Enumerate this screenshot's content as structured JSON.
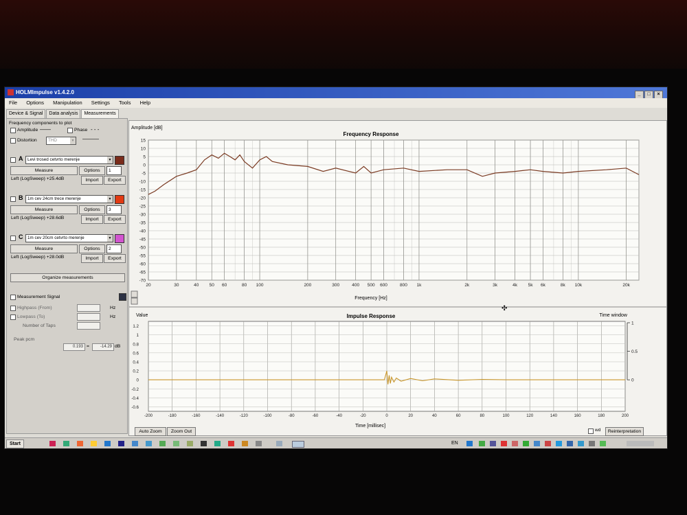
{
  "app": {
    "title": "HOLMImpulse  v1.4.2.0"
  },
  "menu": [
    "File",
    "Options",
    "Manipulation",
    "Settings",
    "Tools",
    "Help"
  ],
  "tabs": [
    "Device & Signal",
    "Data analysis",
    "Measurements"
  ],
  "left": {
    "components_title": "Frequency components to plot",
    "amplitude": "Amplitude",
    "phase": "Phase",
    "distortion": "Distortion",
    "thd": "THD",
    "measurements": [
      {
        "letter": "A",
        "name": "Levi trosed cetvrto merenje",
        "color": "#7a2b1a",
        "measure": "Measure",
        "options": "Options",
        "num": "1",
        "info": "Left (LogSweep) +25.4dB",
        "import": "Import",
        "export": "Export"
      },
      {
        "letter": "B",
        "name": "1m cev 24cm trece merenje",
        "color": "#e23a12",
        "measure": "Measure",
        "options": "Options",
        "num": "3",
        "info": "Left (LogSweep) +28.6dB",
        "import": "Import",
        "export": "Export"
      },
      {
        "letter": "C",
        "name": "1m cev 20cm cetvrto merenje",
        "color": "#d255cf",
        "measure": "Measure",
        "options": "Options",
        "num": "2",
        "info": "Left (LogSweep) +28.0dB",
        "import": "Import",
        "export": "Export"
      }
    ],
    "organize": "Organize measurements",
    "measurement_signal": "Measurement Signal",
    "highpass": "Highpass (From)",
    "lowpass": "Lowpass (To)",
    "taps": "Number of Taps",
    "hz": "Hz",
    "peak_label": "Peak pcm",
    "peak_value": "0.193",
    "peak_equals": "=",
    "peak_db": "-14.29",
    "db": "dB"
  },
  "chart_data": [
    {
      "type": "line",
      "title": "Frequency Response",
      "ylabel": "Amplitude [dB]",
      "xlabel": "Frequency [Hz]",
      "x_scale": "log",
      "xlim": [
        20,
        24000
      ],
      "ylim": [
        -70,
        15
      ],
      "yticks": [
        15,
        10,
        5,
        0,
        -5,
        -10,
        -15,
        -20,
        -25,
        -30,
        -35,
        -40,
        -45,
        -50,
        -55,
        -60,
        -65,
        -70
      ],
      "xticks": [
        20,
        30,
        40,
        50,
        60,
        80,
        100,
        200,
        300,
        400,
        500,
        600,
        800,
        1000,
        2000,
        3000,
        4000,
        5000,
        6000,
        8000,
        10000,
        20000
      ],
      "xtick_labels": [
        "20",
        "30",
        "40",
        "50",
        "60",
        "80",
        "100",
        "200",
        "300",
        "400",
        "500",
        "600",
        "800",
        "1k",
        "2k",
        "3k",
        "4k",
        "5k",
        "6k",
        "8k",
        "10k",
        "20k"
      ],
      "series": [
        {
          "color": "#7a3a22",
          "x": [
            20,
            22,
            25,
            30,
            35,
            40,
            45,
            50,
            55,
            60,
            65,
            70,
            75,
            80,
            90,
            100,
            110,
            120,
            150,
            200,
            250,
            300,
            400,
            450,
            500,
            600,
            800,
            1000,
            1500,
            2000,
            2500,
            3000,
            4000,
            5000,
            6000,
            8000,
            10000,
            15000,
            20000,
            24000
          ],
          "y": [
            -18,
            -16,
            -12,
            -7,
            -5,
            -3,
            3,
            6,
            4,
            7,
            5,
            3,
            6,
            2,
            -2,
            3,
            5,
            2,
            0,
            -1,
            -4,
            -2,
            -5,
            -1,
            -5,
            -3,
            -2,
            -4,
            -3,
            -3,
            -7,
            -5,
            -4,
            -3,
            -4,
            -5,
            -4,
            -3,
            -2,
            -6
          ]
        }
      ]
    },
    {
      "type": "line",
      "title": "Impulse Response",
      "ylabel": "Value",
      "xlabel": "Time [millisec]",
      "xlim": [
        -200,
        200
      ],
      "ylim": [
        -0.7,
        1.3
      ],
      "yticks": [
        1.2,
        1,
        0.8,
        0.6,
        0.4,
        0.2,
        0,
        -0.2,
        -0.4,
        -0.6
      ],
      "xticks": [
        -200,
        -180,
        -160,
        -140,
        -120,
        -100,
        -80,
        -60,
        -40,
        -20,
        0,
        20,
        40,
        60,
        80,
        100,
        120,
        140,
        160,
        180,
        200
      ],
      "right_axis_label": "Time window",
      "right_ticks": [
        "1",
        "0.5",
        "0"
      ],
      "series": [
        {
          "color": "#c9962a",
          "x": [
            -200,
            -2,
            0,
            1,
            2,
            3,
            4,
            6,
            8,
            12,
            20,
            30,
            40,
            60,
            80,
            100,
            110,
            200
          ],
          "y": [
            0,
            0,
            0.2,
            -0.1,
            0.1,
            -0.08,
            0.06,
            -0.05,
            0.04,
            -0.03,
            0.03,
            -0.02,
            0.02,
            -0.01,
            0.01,
            0,
            0,
            0
          ]
        }
      ]
    }
  ],
  "bottom": {
    "autozoom": "Auto Zoom",
    "zoomout": "Zoom Out",
    "wdelay": "wd",
    "reinterpret": "Reinterpretation"
  },
  "taskbar": {
    "start": "Start",
    "lang": "EN"
  }
}
